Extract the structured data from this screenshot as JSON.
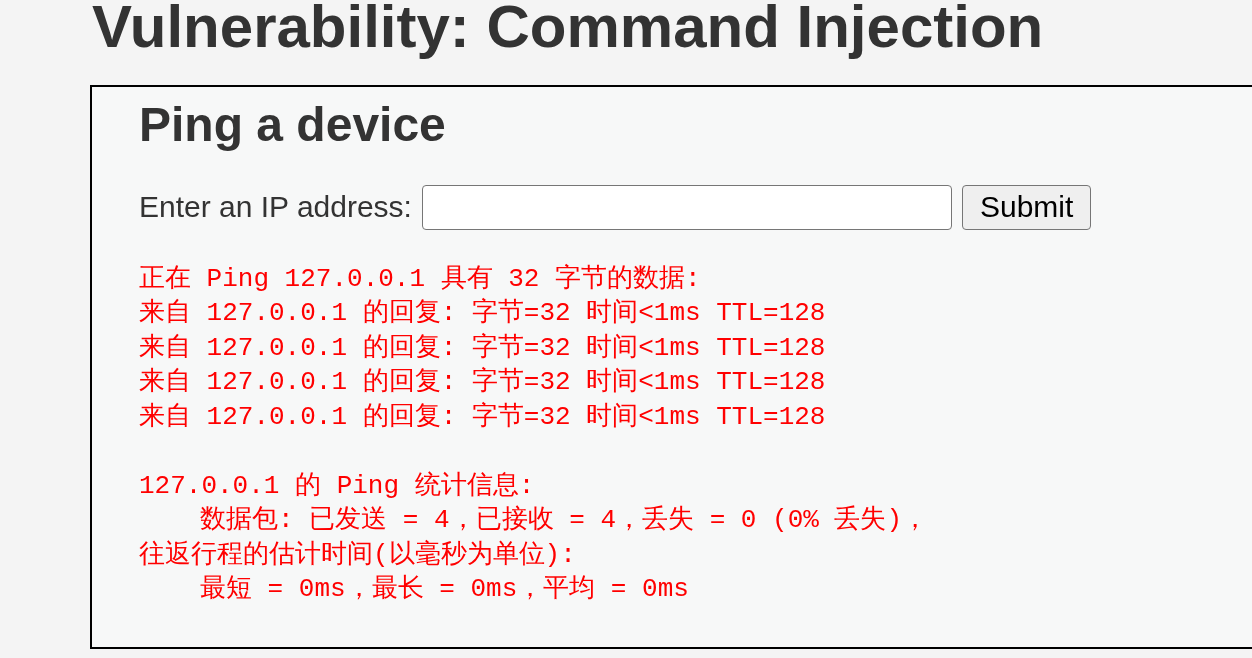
{
  "page": {
    "title": "Vulnerability: Command Injection"
  },
  "panel": {
    "heading": "Ping a device",
    "form": {
      "label": "Enter an IP address:",
      "button": "Submit"
    },
    "output": {
      "blocks": [
        {
          "lines": [
            {
              "text": "正在 Ping 127.0.0.1 具有 32 字节的数据:"
            },
            {
              "text": "来自 127.0.0.1 的回复: 字节=32 时间<1ms TTL=128"
            },
            {
              "text": "来自 127.0.0.1 的回复: 字节=32 时间<1ms TTL=128"
            },
            {
              "text": "来自 127.0.0.1 的回复: 字节=32 时间<1ms TTL=128"
            },
            {
              "text": "来自 127.0.0.1 的回复: 字节=32 时间<1ms TTL=128"
            }
          ]
        },
        {
          "lines": [
            {
              "text": "127.0.0.1 的 Ping 统计信息:",
              "children": [
                {
                  "text": "数据包: 已发送 = 4，已接收 = 4，丢失 = 0 (0% 丢失)，"
                }
              ]
            },
            {
              "text": "往返行程的估计时间(以毫秒为单位):",
              "children": [
                {
                  "text": "最短 = 0ms，最长 = 0ms，平均 = 0ms"
                }
              ]
            }
          ]
        }
      ]
    }
  }
}
